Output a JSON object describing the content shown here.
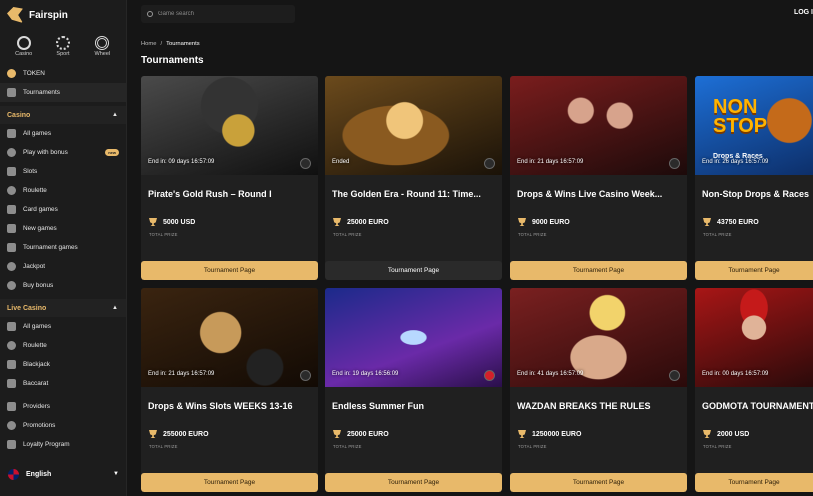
{
  "brand": {
    "name": "Fairspin"
  },
  "modes": [
    {
      "label": "Casino",
      "icon": "casino-icon"
    },
    {
      "label": "Sport",
      "icon": "sport-icon"
    },
    {
      "label": "Wheel",
      "icon": "wheel-icon"
    }
  ],
  "sidebar": {
    "token": "TOKEN",
    "tournaments": "Tournaments",
    "casino_head": "Casino",
    "casino_items": [
      "All games",
      "Play with bonus",
      "Slots",
      "Roulette",
      "Card games",
      "New games",
      "Tournament games",
      "Jackpot",
      "Buy bonus"
    ],
    "new_badge": "new",
    "live_head": "Live Casino",
    "live_items": [
      "All games",
      "Roulette",
      "Blackjack",
      "Baccarat"
    ],
    "extra_items": [
      "Providers",
      "Promotions",
      "Loyalty Program"
    ],
    "language": "English"
  },
  "topbar": {
    "search_placeholder": "Game search",
    "login": "LOG I"
  },
  "breadcrumb": {
    "home": "Home",
    "sep": "/",
    "current": "Tournaments"
  },
  "page_title": "Tournaments",
  "tournaments": [
    {
      "ends": "End in: 09 days 16:57:09",
      "name": "Pirate's Gold Rush – Round I",
      "prize": "5000 USD",
      "prize_label": "TOTAL PRIZE",
      "button": "Tournament Page"
    },
    {
      "ends": "Ended",
      "name": "The Golden Era - Round 11: Time...",
      "prize": "25000 EURO",
      "prize_label": "TOTAL PRIZE",
      "button": "Tournament Page"
    },
    {
      "ends": "End in: 21 days 16:57:09",
      "name": "Drops & Wins Live Casino Week...",
      "prize": "9000 EURO",
      "prize_label": "TOTAL PRIZE",
      "button": "Tournament Page"
    },
    {
      "ends": "End in: 26 days 16:57:09",
      "name": "Non-Stop Drops & Races",
      "prize": "43750 EURO",
      "prize_label": "TOTAL PRIZE",
      "button": "Tournament Page",
      "art_title": "NON STOP",
      "art_sub": "Drops & Races"
    },
    {
      "ends": "End in: 21 days 16:57:09",
      "name": "Drops & Wins Slots WEEKS 13-16",
      "prize": "255000 EURO",
      "prize_label": "TOTAL PRIZE",
      "button": "Tournament Page"
    },
    {
      "ends": "End in: 19 days 16:56:09",
      "name": "Endless Summer Fun",
      "prize": "25000 EURO",
      "prize_label": "TOTAL PRIZE",
      "button": "Tournament Page"
    },
    {
      "ends": "End in: 41 days 16:57:09",
      "name": "WAZDAN BREAKS THE RULES",
      "prize": "1250000 EURO",
      "prize_label": "TOTAL PRIZE",
      "button": "Tournament Page"
    },
    {
      "ends": "End in: 00 days 16:57:09",
      "name": "GODMOTA TOURNAMENT",
      "prize": "2000 USD",
      "prize_label": "TOTAL PRIZE",
      "button": "Tournament Page"
    }
  ]
}
